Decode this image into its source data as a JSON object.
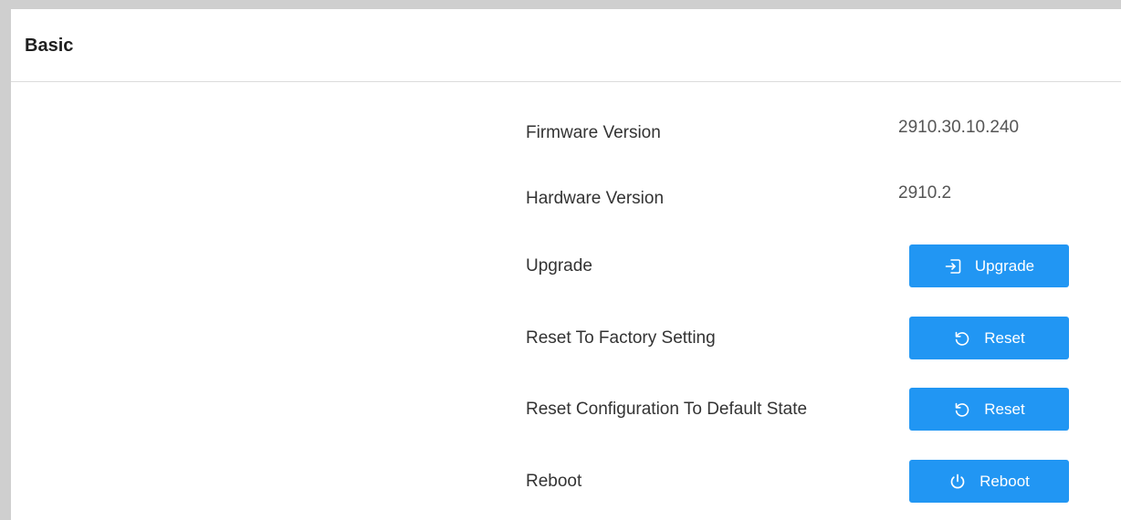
{
  "header": {
    "title": "Basic"
  },
  "rows": [
    {
      "label": "Firmware Version",
      "value": "2910.30.10.240"
    },
    {
      "label": "Hardware Version",
      "value": "2910.2"
    },
    {
      "label": "Upgrade",
      "button_label": "Upgrade",
      "icon": "upload-enter-icon"
    },
    {
      "label": "Reset To Factory Setting",
      "button_label": "Reset",
      "icon": "reset-icon"
    },
    {
      "label": "Reset Configuration To Default State",
      "button_label": "Reset",
      "icon": "reset-icon"
    },
    {
      "label": "Reboot",
      "button_label": "Reboot",
      "icon": "power-icon"
    }
  ],
  "colors": {
    "accent": "#2196f3",
    "background": "#ffffff",
    "frame": "#cfcfcf"
  }
}
